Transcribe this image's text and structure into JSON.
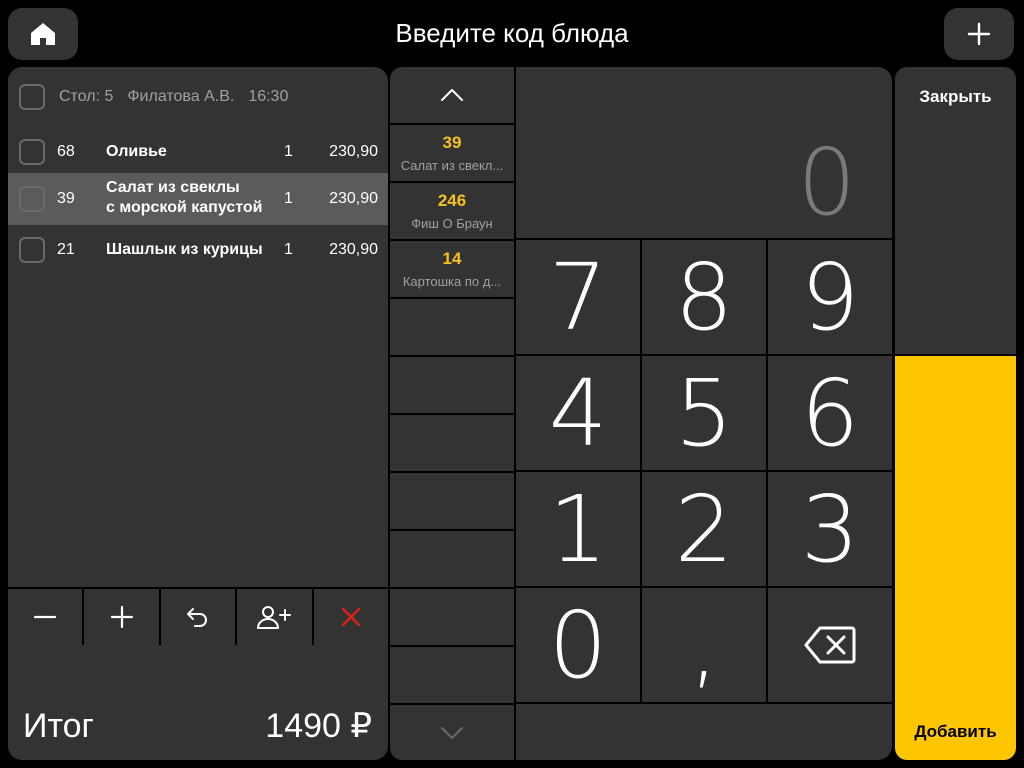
{
  "header": {
    "title": "Введите код блюда",
    "home_icon": "home-icon",
    "add_icon": "plus-icon"
  },
  "order": {
    "meta": {
      "table": "Стол: 5",
      "waiter": "Филатова А.В.",
      "time": "16:30"
    },
    "items": [
      {
        "code": "68",
        "name_line1": "Оливье",
        "name_line2": "",
        "qty": "1",
        "price": "230,90",
        "selected": false
      },
      {
        "code": "39",
        "name_line1": "Салат из свеклы",
        "name_line2": "с морской капустой",
        "qty": "1",
        "price": "230,90",
        "selected": true
      },
      {
        "code": "21",
        "name_line1": "Шашлык из курицы",
        "name_line2": "",
        "qty": "1",
        "price": "230,90",
        "selected": false
      }
    ],
    "actions": [
      {
        "name": "decrease-quantity-button",
        "icon": "minus-icon"
      },
      {
        "name": "increase-quantity-button",
        "icon": "plus-icon"
      },
      {
        "name": "undo-button",
        "icon": "undo-icon"
      },
      {
        "name": "add-guest-button",
        "icon": "add-user-icon"
      },
      {
        "name": "delete-button",
        "icon": "close-icon",
        "color": "#e0201c"
      }
    ],
    "total_label": "Итог",
    "total_value": "1490 ₽"
  },
  "recent": {
    "items": [
      {
        "code": "39",
        "name": "Салат из свекл..."
      },
      {
        "code": "246",
        "name": "Фиш О Браун"
      },
      {
        "code": "14",
        "name": "Картошка по д..."
      }
    ]
  },
  "keypad": {
    "display_value": "0",
    "keys": [
      "7",
      "8",
      "9",
      "4",
      "5",
      "6",
      "1",
      "2",
      "3",
      "0",
      ","
    ],
    "backspace_icon": "backspace-icon"
  },
  "side": {
    "close_label": "Закрыть",
    "add_label": "Добавить"
  },
  "colors": {
    "panel": "#333333",
    "accent": "#fec600",
    "code_highlight": "#f7c11c",
    "danger": "#e0201c",
    "selected_row": "#5b5b5b"
  }
}
